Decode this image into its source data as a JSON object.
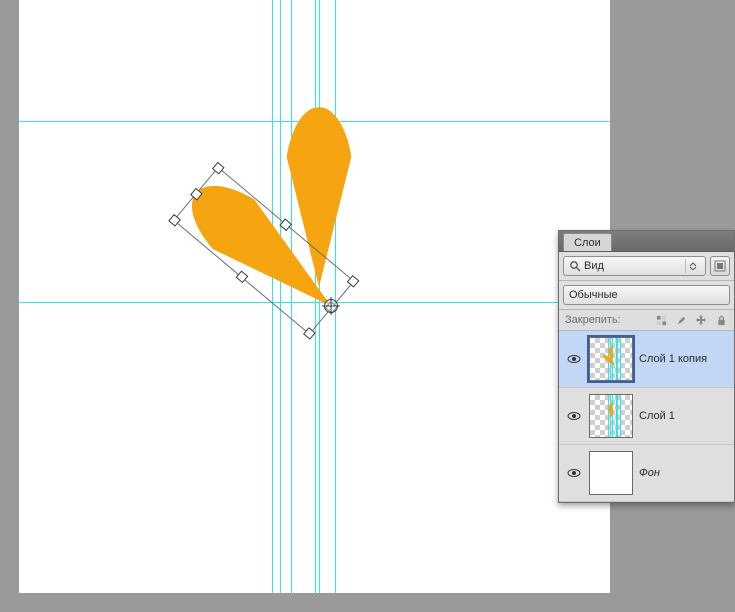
{
  "canvas": {
    "guides": {
      "horizontal": [
        121,
        302
      ],
      "vertical": [
        253,
        261,
        272,
        296,
        300,
        316
      ]
    }
  },
  "panel": {
    "tab_label": "Слои",
    "kind_label": "Вид",
    "blend_mode": "Обычные",
    "lock_label": "Закрепить:"
  },
  "layers": [
    {
      "name": "Слой 1 копия",
      "visible": true,
      "selected": true,
      "thumb": "petal_rotated",
      "italic": false
    },
    {
      "name": "Слой 1",
      "visible": true,
      "selected": false,
      "thumb": "petal_vert",
      "italic": false
    },
    {
      "name": "Фон",
      "visible": true,
      "selected": false,
      "thumb": "white",
      "italic": true
    }
  ]
}
